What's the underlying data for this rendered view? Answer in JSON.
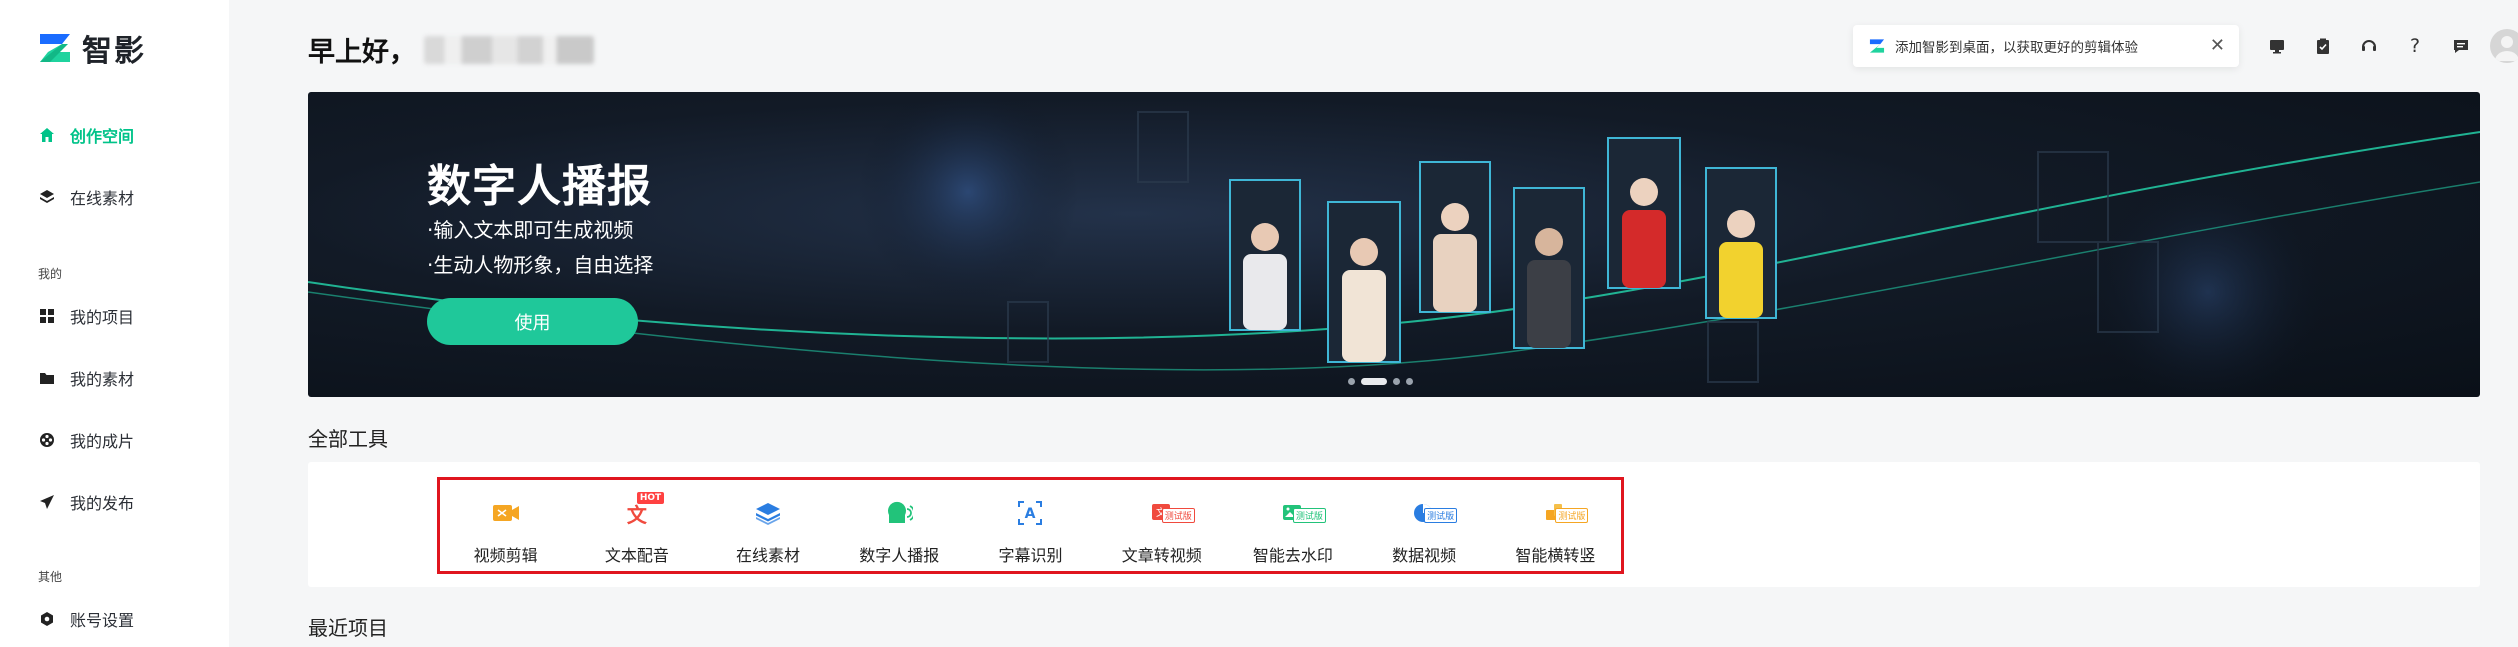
{
  "app": {
    "logo_text": "智影"
  },
  "sidebar": {
    "items_top": [
      {
        "label": "创作空间",
        "icon": "home-icon",
        "active": true
      },
      {
        "label": "在线素材",
        "icon": "layers-icon",
        "active": false
      }
    ],
    "group_mine_label": "我的",
    "items_mine": [
      {
        "label": "我的项目",
        "icon": "grid-icon"
      },
      {
        "label": "我的素材",
        "icon": "folder-icon"
      },
      {
        "label": "我的成片",
        "icon": "film-reel-icon"
      },
      {
        "label": "我的发布",
        "icon": "send-icon"
      }
    ],
    "group_other_label": "其他",
    "items_other": [
      {
        "label": "账号设置",
        "icon": "settings-icon"
      }
    ]
  },
  "header": {
    "greeting": "早上好，",
    "notice_text": "添加智影到桌面，以获取更好的剪辑体验",
    "icons": [
      "monitor-icon",
      "clipboard-icon",
      "headset-icon",
      "help-icon",
      "message-icon",
      "avatar"
    ]
  },
  "banner": {
    "title": "数字人播报",
    "lines": [
      "·输入文本即可生成视频",
      "·生动人物形象，自由选择"
    ],
    "button": "使用",
    "slide_count": 4,
    "active_slide": 1
  },
  "tools": {
    "section_title": "全部工具",
    "items": [
      {
        "label": "视频剪辑",
        "icon": "video-edit-icon",
        "color": "#f5a623",
        "badge": ""
      },
      {
        "label": "文本配音",
        "icon": "text-voice-icon",
        "color": "#f04a3e",
        "badge": "HOT"
      },
      {
        "label": "在线素材",
        "icon": "layers-icon",
        "color": "#2a7de1",
        "badge": ""
      },
      {
        "label": "数字人播报",
        "icon": "digital-human-icon",
        "color": "#22c37a",
        "badge": ""
      },
      {
        "label": "字幕识别",
        "icon": "subtitle-recognition-icon",
        "color": "#2a7de1",
        "badge": ""
      },
      {
        "label": "文章转视频",
        "icon": "article-to-video-icon",
        "color": "#f04a3e",
        "badge": "测试版"
      },
      {
        "label": "智能去水印",
        "icon": "remove-watermark-icon",
        "color": "#22c37a",
        "badge": "测试版"
      },
      {
        "label": "数据视频",
        "icon": "data-video-icon",
        "color": "#2a7de1",
        "badge": "测试版"
      },
      {
        "label": "智能横转竖",
        "icon": "rotate-layout-icon",
        "color": "#f5a623",
        "badge": "测试版"
      }
    ]
  },
  "recent": {
    "section_title": "最近项目"
  },
  "colors": {
    "accent": "#00c389",
    "highlight_border": "#e0161f"
  }
}
